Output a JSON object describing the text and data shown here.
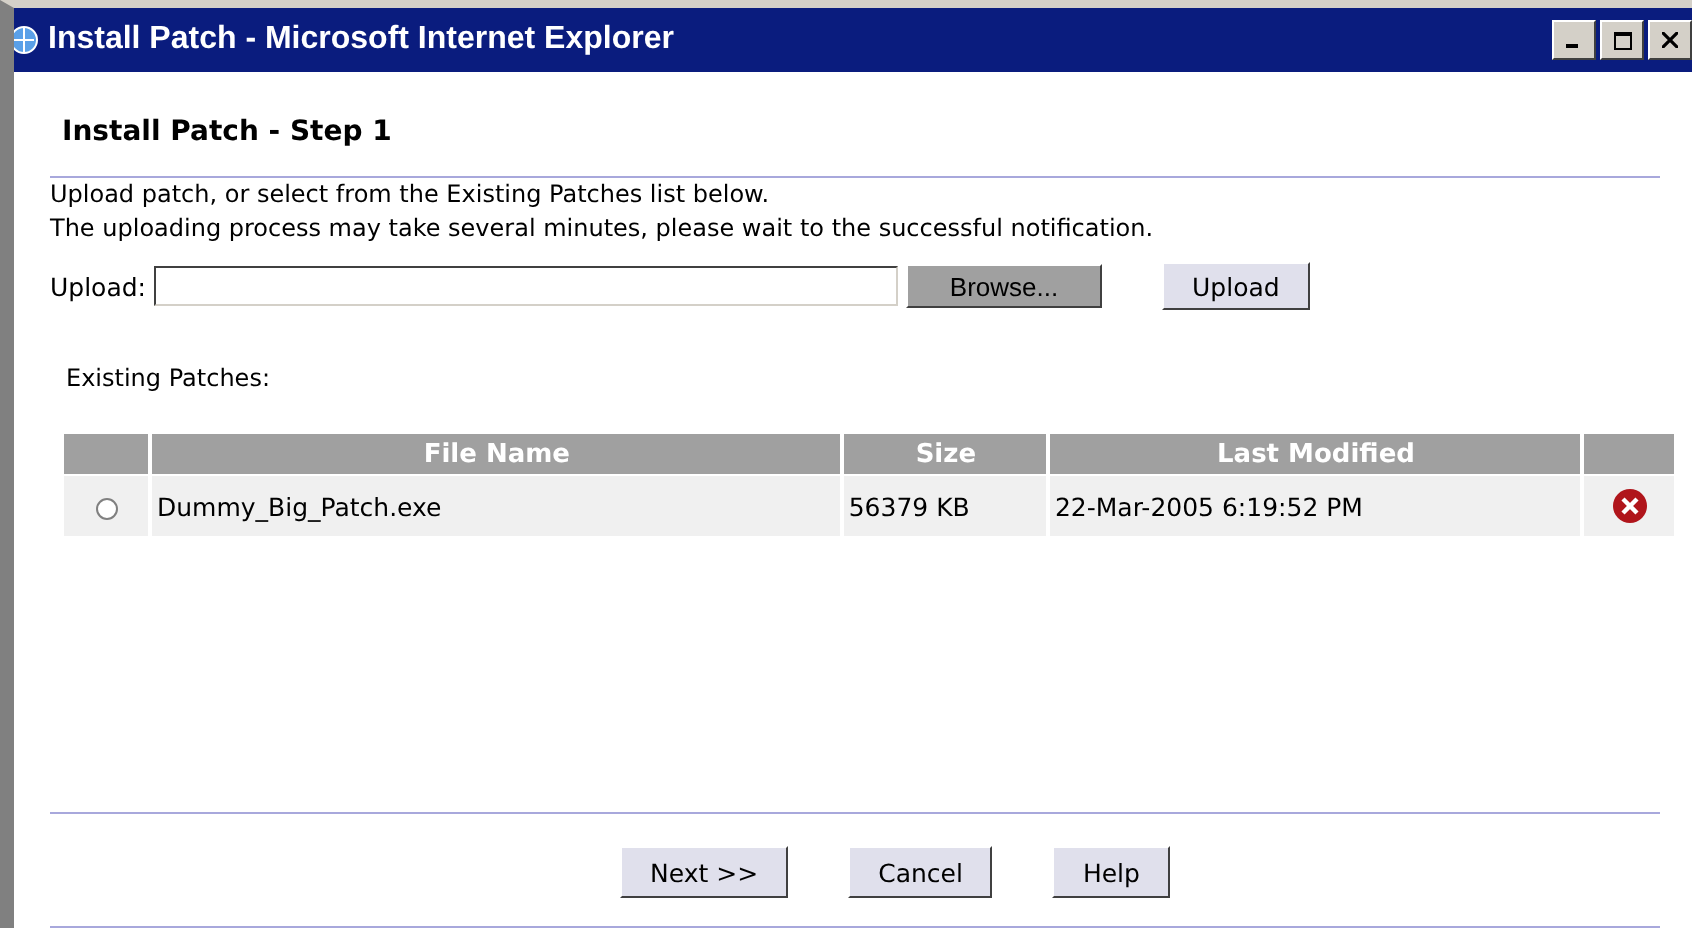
{
  "window": {
    "title": "Install Patch - Microsoft Internet Explorer"
  },
  "heading": "Install Patch - Step 1",
  "intro": [
    "Upload patch, or select from the Existing Patches list below.",
    "The uploading process may take several minutes, please wait to the successful notification."
  ],
  "upload": {
    "label": "Upload:",
    "browse": "Browse...",
    "button": "Upload"
  },
  "existing_label": "Existing Patches:",
  "table": {
    "columns": [
      "File Name",
      "Size",
      "Last Modified"
    ],
    "rows": [
      {
        "selected": false,
        "file_name": "Dummy_Big_Patch.exe",
        "size": "56379 KB",
        "last_modified": "22-Mar-2005 6:19:52 PM"
      }
    ]
  },
  "buttons": [
    "Next >>",
    "Cancel",
    "Help"
  ]
}
